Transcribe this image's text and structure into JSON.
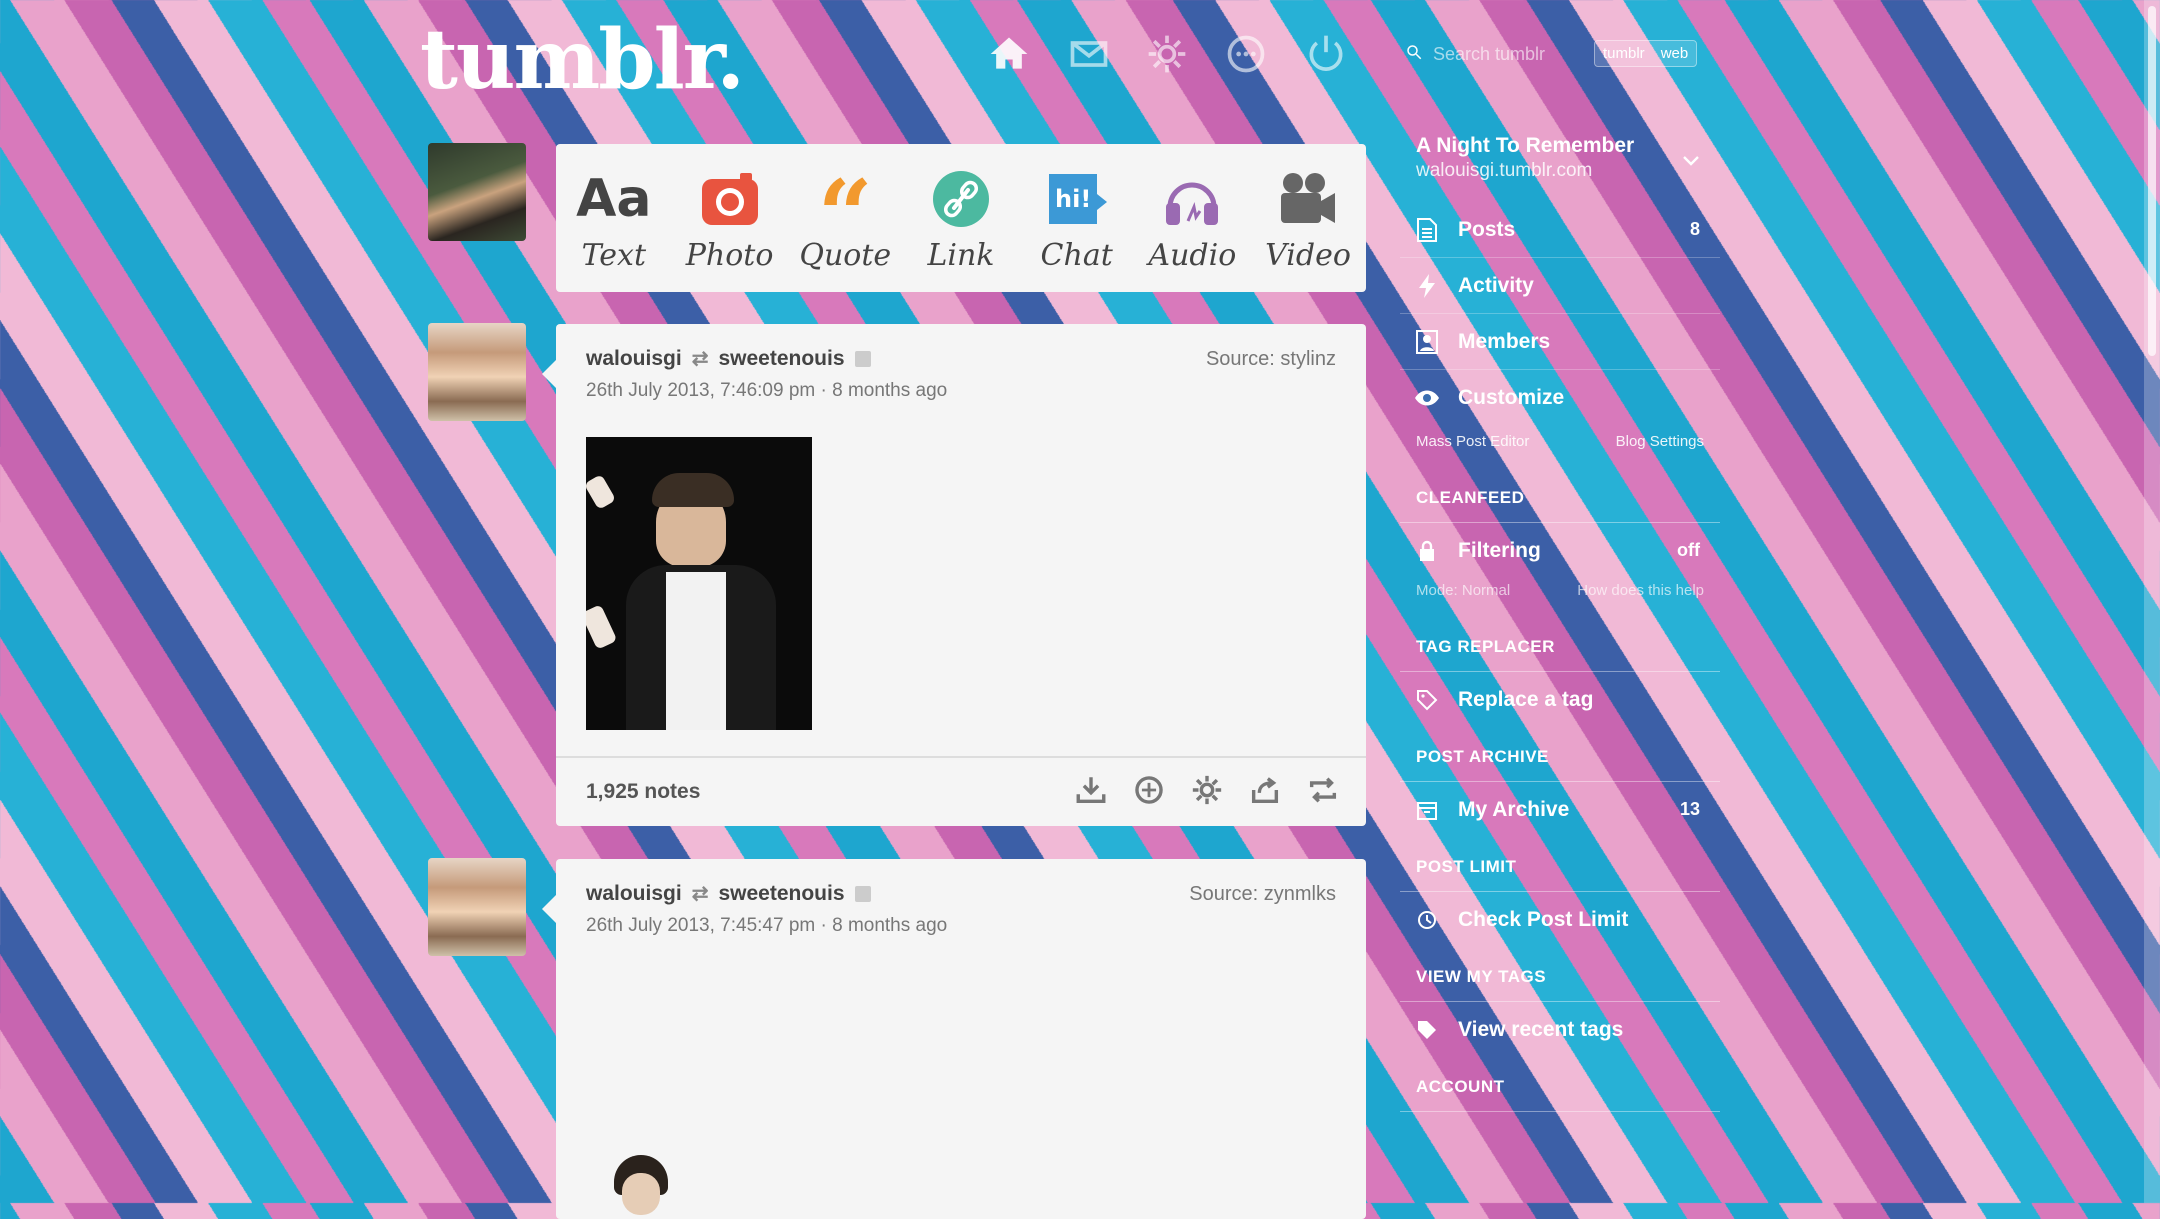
{
  "header": {
    "logo": "tumblr.",
    "icons": [
      "home-icon",
      "mail-icon",
      "gear-icon",
      "chat-icon",
      "power-icon"
    ],
    "search_placeholder": "Search tumblr",
    "toggle": [
      "tumblr",
      "web"
    ]
  },
  "post_types": [
    {
      "label": "Text",
      "icon": "text-icon",
      "color": "#444444"
    },
    {
      "label": "Photo",
      "icon": "camera-icon",
      "color": "#e8543f"
    },
    {
      "label": "Quote",
      "icon": "quote-icon",
      "color": "#f2992e"
    },
    {
      "label": "Link",
      "icon": "link-icon",
      "color": "#4cb9a0"
    },
    {
      "label": "Chat",
      "icon": "chat-bubble-icon",
      "color": "#3c99d6"
    },
    {
      "label": "Audio",
      "icon": "headphones-icon",
      "color": "#9a6ab2"
    },
    {
      "label": "Video",
      "icon": "video-camera-icon",
      "color": "#666666"
    }
  ],
  "posts": [
    {
      "author": "walouisgi",
      "reblogged_from": "sweetenouis",
      "date": "26th July 2013, 7:46:09 pm · 8 months ago",
      "source": "Source: stylinz",
      "notes": "1,925 notes"
    },
    {
      "author": "walouisgi",
      "reblogged_from": "sweetenouis",
      "date": "26th July 2013, 7:45:47 pm · 8 months ago",
      "source": "Source: zynmlks"
    }
  ],
  "sidebar": {
    "blog_title": "A Night To Remember",
    "blog_url": "walouisgi.tumblr.com",
    "menu": [
      {
        "label": "Posts",
        "icon": "document-icon",
        "count": "8"
      },
      {
        "label": "Activity",
        "icon": "lightning-icon"
      },
      {
        "label": "Members",
        "icon": "members-icon"
      },
      {
        "label": "Customize",
        "icon": "eye-icon"
      }
    ],
    "links": [
      "Mass Post Editor",
      "Blog Settings"
    ],
    "cleanfeed": {
      "heading": "CLEANFEED",
      "label": "Filtering",
      "value": "off",
      "mode": "Mode: Normal",
      "help": "How does this help"
    },
    "tag_replacer": {
      "heading": "TAG REPLACER",
      "label": "Replace a tag"
    },
    "post_archive": {
      "heading": "POST ARCHIVE",
      "label": "My Archive",
      "count": "13"
    },
    "post_limit": {
      "heading": "POST LIMIT",
      "label": "Check Post Limit"
    },
    "view_tags": {
      "heading": "VIEW MY TAGS",
      "label": "View recent tags"
    },
    "account": {
      "heading": "ACCOUNT"
    }
  }
}
